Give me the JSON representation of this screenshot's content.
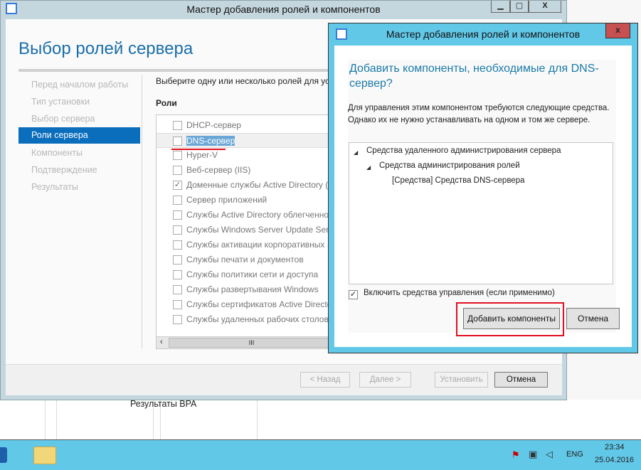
{
  "main_window": {
    "title": "Мастер добавления ролей и компонентов",
    "page_title": "Выбор ролей сервера",
    "nav": [
      {
        "label": "Перед началом работы",
        "active": false
      },
      {
        "label": "Тип установки",
        "active": false
      },
      {
        "label": "Выбор сервера",
        "active": false
      },
      {
        "label": "Роли сервера",
        "active": true
      },
      {
        "label": "Компоненты",
        "active": false
      },
      {
        "label": "Подтверждение",
        "active": false
      },
      {
        "label": "Результаты",
        "active": false
      }
    ],
    "intro": "Выберите одну или несколько ролей для ус",
    "roles_header": "Роли",
    "roles": [
      {
        "label": "DHCP-сервер",
        "checked": false
      },
      {
        "label": "DNS-сервер",
        "checked": false,
        "selected": true
      },
      {
        "label": "Hyper-V",
        "checked": false
      },
      {
        "label": "Веб-сервер (IIS)",
        "checked": false
      },
      {
        "label": "Доменные службы Active Directory (",
        "checked": true
      },
      {
        "label": "Сервер приложений",
        "checked": false
      },
      {
        "label": "Службы Active Directory облегченно",
        "checked": false
      },
      {
        "label": "Службы Windows Server Update Serv",
        "checked": false
      },
      {
        "label": "Службы активации корпоративных .",
        "checked": false
      },
      {
        "label": "Службы печати и документов",
        "checked": false
      },
      {
        "label": "Службы политики сети и доступа",
        "checked": false
      },
      {
        "label": "Службы развертывания Windows",
        "checked": false
      },
      {
        "label": "Службы сертификатов Active Directo",
        "checked": false
      },
      {
        "label": "Службы удаленных рабочих столов",
        "checked": false
      }
    ],
    "buttons": {
      "back": "< Назад",
      "next": "Далее >",
      "install": "Установить",
      "cancel": "Отмена"
    }
  },
  "background": {
    "bpa": "Результаты BPA"
  },
  "dialog": {
    "title": "Мастер добавления ролей и компонентов",
    "heading": "Добавить компоненты, необходимые для DNS-сервер?",
    "text": "Для управления этим компонентом требуются следующие средства. Однако их не нужно устанавливать на одном и том же сервере.",
    "tree": [
      "Средства удаленного администрирования сервера",
      "Средства администрирования ролей",
      "[Средства] Средства DNS-сервера"
    ],
    "include_tools": "Включить средства управления (если применимо)",
    "include_checked": true,
    "add_button": "Добавить компоненты",
    "cancel_button": "Отмена",
    "close": "x"
  },
  "taskbar": {
    "lang": "ENG",
    "time": "23:34",
    "date": "25.04.2016"
  },
  "colors": {
    "accent": "#0a6ebd",
    "taskbar": "#62c8e8",
    "highlight": "#e01020"
  }
}
